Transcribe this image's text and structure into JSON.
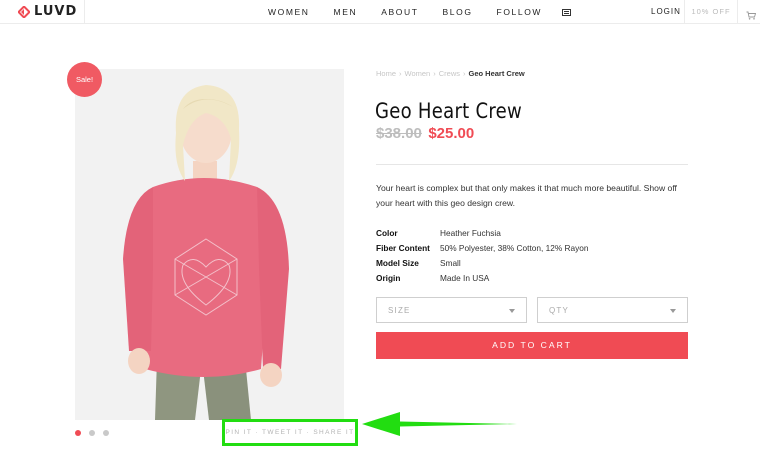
{
  "brand": {
    "name": "LUVD",
    "accent": "#f04b54"
  },
  "nav": {
    "items": [
      "WOMEN",
      "MEN",
      "ABOUT",
      "BLOG",
      "FOLLOW"
    ],
    "login": "LOGIN",
    "promo": "10% OFF"
  },
  "product": {
    "badge": "Sale!",
    "breadcrumb": [
      "Home",
      "Women",
      "Crews",
      "Geo Heart Crew"
    ],
    "title": "Geo Heart Crew",
    "price_old": "$38.00",
    "price_new": "$25.00",
    "description": "Your heart is complex but that only makes it that much more beautiful. Show off your heart with this geo design crew.",
    "specs": [
      {
        "label": "Color",
        "value": "Heather Fuchsia"
      },
      {
        "label": "Fiber Content",
        "value": "50% Polyester, 38% Cotton, 12% Rayon"
      },
      {
        "label": "Model Size",
        "value": "Small"
      },
      {
        "label": "Origin",
        "value": "Made In USA"
      }
    ],
    "size_placeholder": "SIZE",
    "qty_placeholder": "QTY",
    "add_to_cart": "ADD TO CART",
    "share_text": "PIN IT · TWEET IT · SHARE IT",
    "carousel_dots": 3,
    "carousel_active": 0
  },
  "highlight_color": "#22dd11"
}
